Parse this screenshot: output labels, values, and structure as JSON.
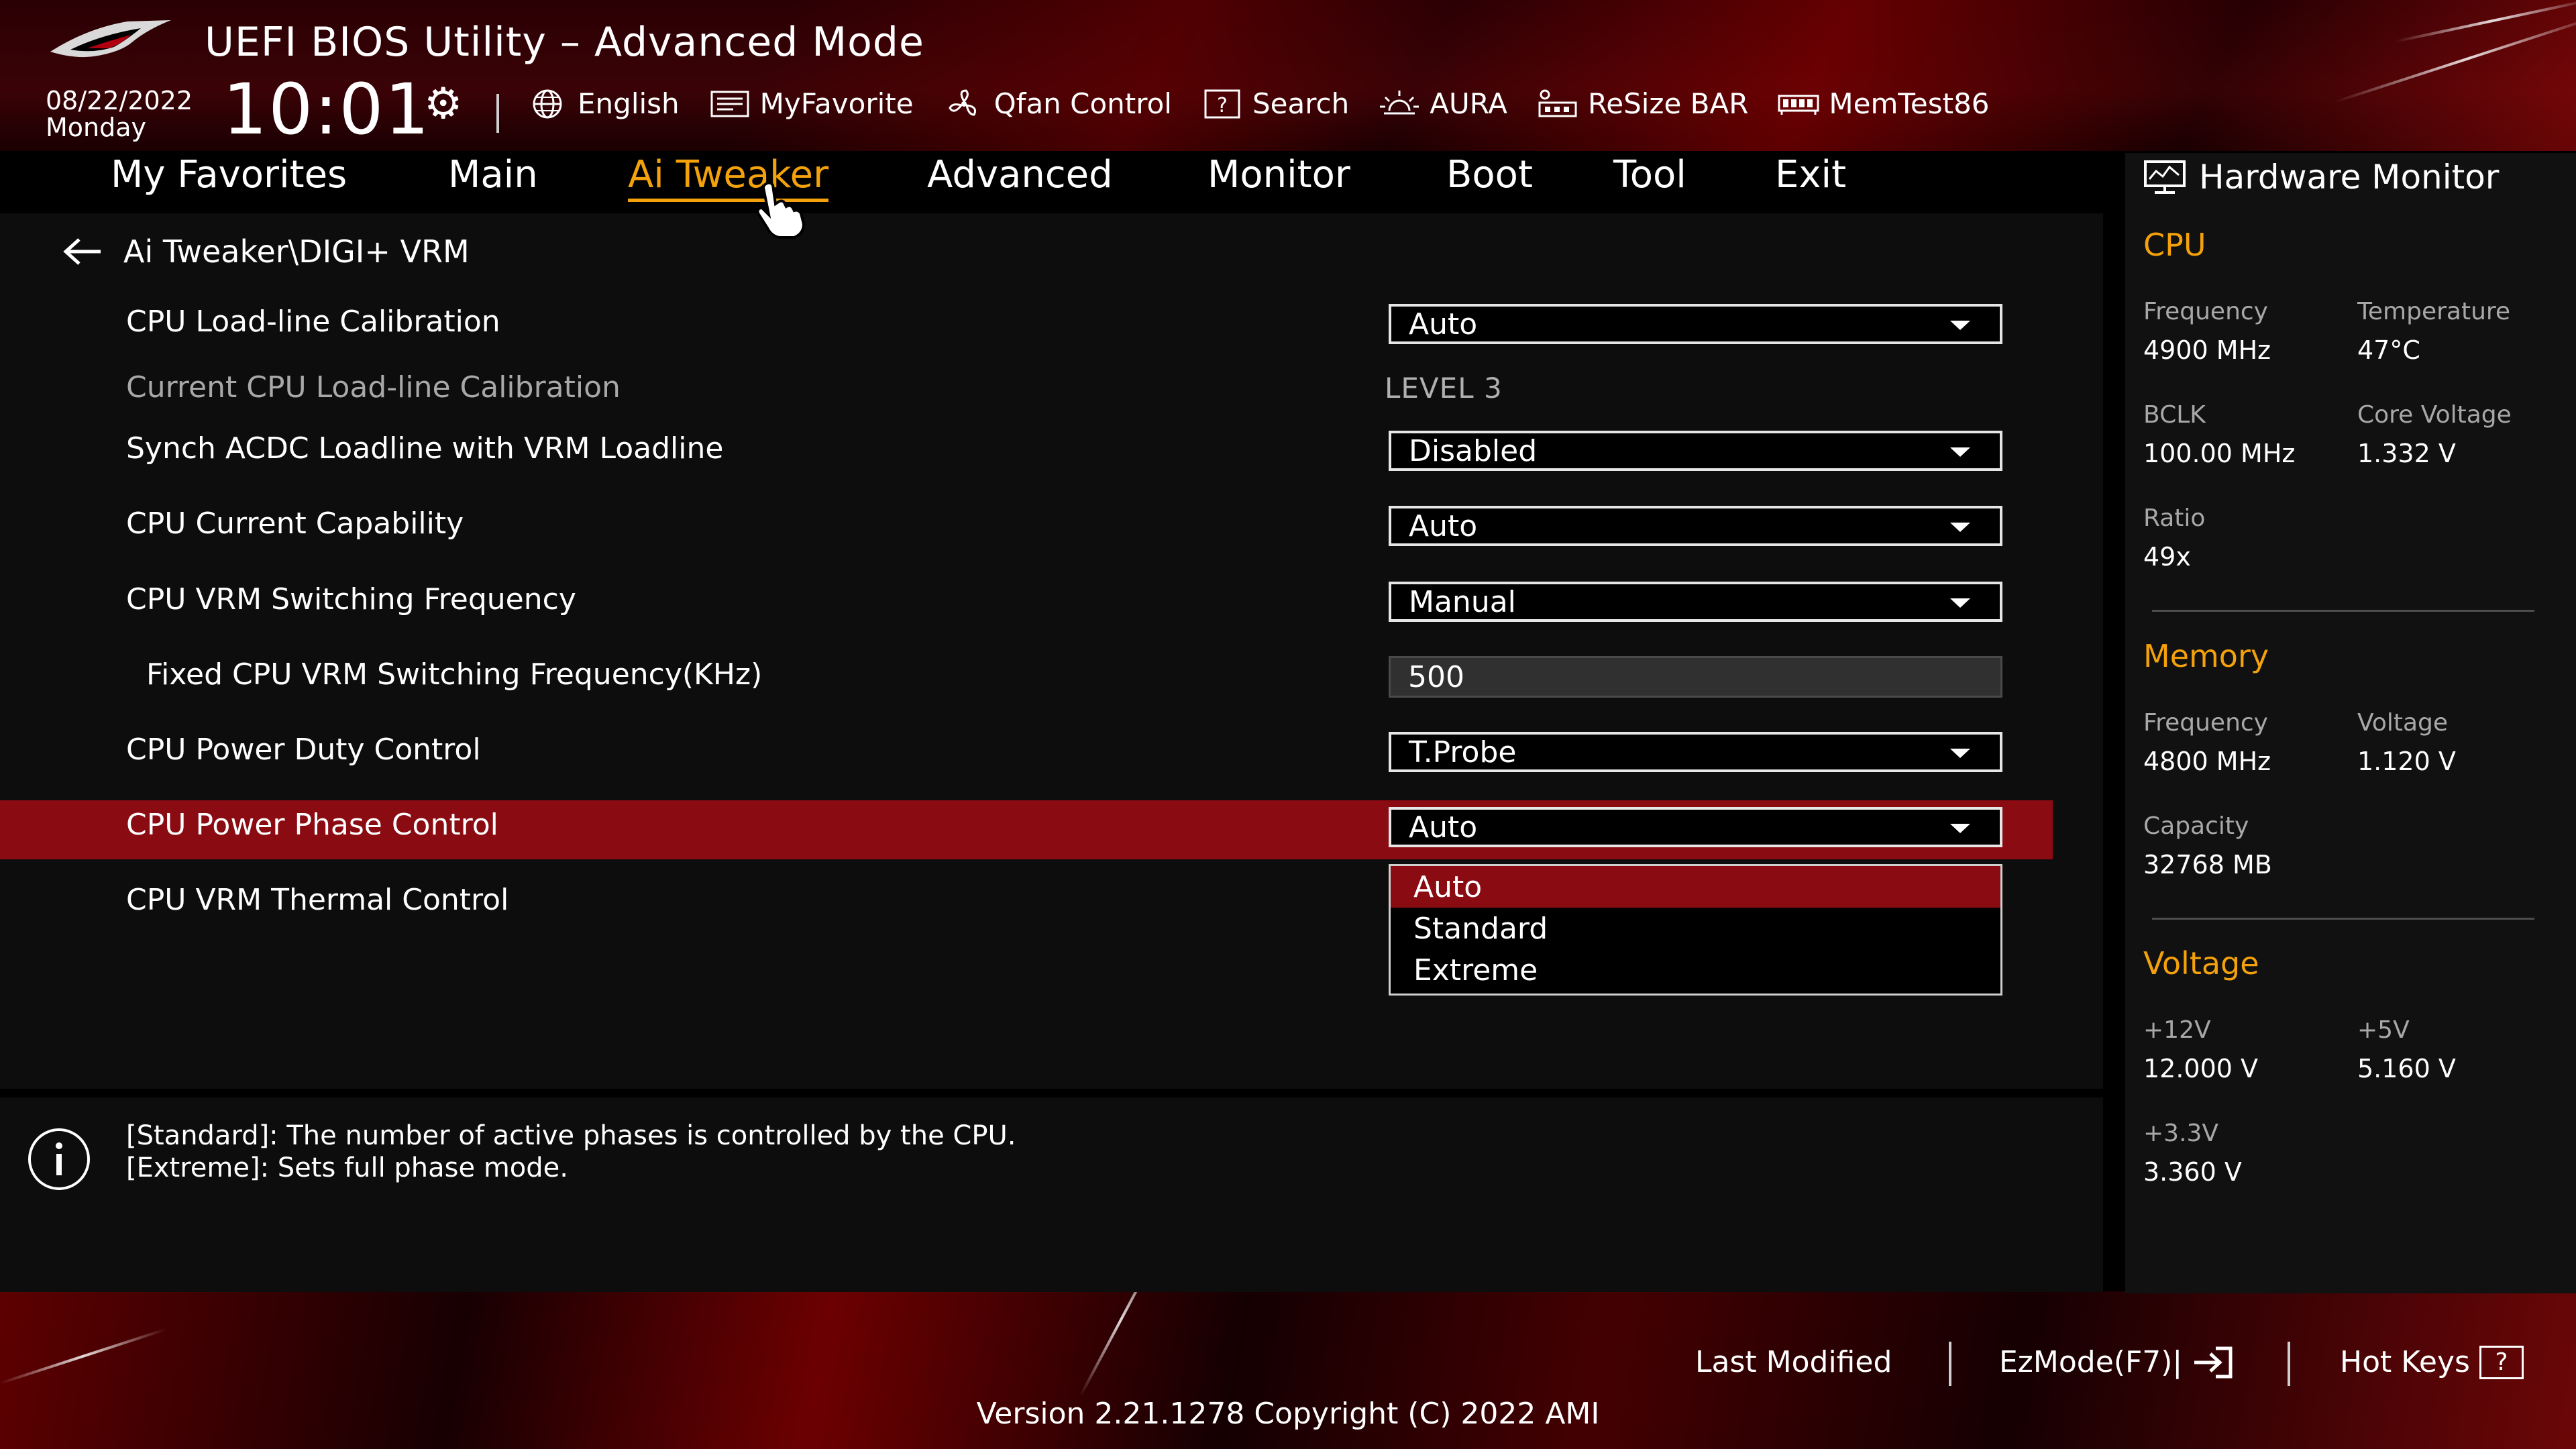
{
  "header": {
    "title": "UEFI BIOS Utility – Advanced Mode",
    "date": "08/22/2022",
    "day": "Monday",
    "time": "10:01",
    "tools": [
      {
        "label": "English",
        "icon": "globe-icon"
      },
      {
        "label": "MyFavorite",
        "icon": "favorite-icon"
      },
      {
        "label": "Qfan Control",
        "icon": "fan-icon"
      },
      {
        "label": "Search",
        "icon": "search-help-icon"
      },
      {
        "label": "AURA",
        "icon": "aura-icon"
      },
      {
        "label": "ReSize BAR",
        "icon": "resize-bar-icon"
      },
      {
        "label": "MemTest86",
        "icon": "memtest-icon"
      }
    ]
  },
  "tabs": [
    {
      "label": "My Favorites"
    },
    {
      "label": "Main"
    },
    {
      "label": "Ai Tweaker",
      "active": true
    },
    {
      "label": "Advanced"
    },
    {
      "label": "Monitor"
    },
    {
      "label": "Boot"
    },
    {
      "label": "Tool"
    },
    {
      "label": "Exit"
    }
  ],
  "breadcrumb": "Ai Tweaker\\DIGI+ VRM",
  "settings": [
    {
      "label": "CPU Load-line Calibration",
      "value": "Auto"
    },
    {
      "label": "Current CPU Load-line Calibration",
      "value": "LEVEL 3"
    },
    {
      "label": "Synch ACDC Loadline with VRM Loadline",
      "value": "Disabled"
    },
    {
      "label": "CPU Current Capability",
      "value": "Auto"
    },
    {
      "label": "CPU VRM Switching Frequency",
      "value": "Manual"
    },
    {
      "label": "Fixed CPU VRM Switching Frequency(KHz)",
      "value": "500"
    },
    {
      "label": "CPU Power Duty Control",
      "value": "T.Probe"
    },
    {
      "label": "CPU Power Phase Control",
      "value": "Auto"
    },
    {
      "label": "CPU VRM Thermal Control"
    }
  ],
  "dropdown": {
    "options": [
      "Auto",
      "Standard",
      "Extreme"
    ],
    "selected": "Auto"
  },
  "help": [
    "[Standard]: The number of active phases is controlled by the CPU.",
    "[Extreme]: Sets full phase mode."
  ],
  "hardware_monitor": {
    "title": "Hardware Monitor",
    "cpu": {
      "heading": "CPU",
      "frequency_label": "Frequency",
      "frequency": "4900 MHz",
      "temperature_label": "Temperature",
      "temperature": "47°C",
      "bclk_label": "BCLK",
      "bclk": "100.00 MHz",
      "core_voltage_label": "Core Voltage",
      "core_voltage": "1.332 V",
      "ratio_label": "Ratio",
      "ratio": "49x"
    },
    "memory": {
      "heading": "Memory",
      "frequency_label": "Frequency",
      "frequency": "4800 MHz",
      "voltage_label": "Voltage",
      "voltage": "1.120 V",
      "capacity_label": "Capacity",
      "capacity": "32768 MB"
    },
    "voltage": {
      "heading": "Voltage",
      "v12_label": "+12V",
      "v12": "12.000 V",
      "v5_label": "+5V",
      "v5": "5.160 V",
      "v33_label": "+3.3V",
      "v33": "3.360 V"
    }
  },
  "footer": {
    "last_modified": "Last Modified",
    "ezmode": "EzMode(F7)|",
    "hotkeys": "Hot Keys",
    "hotkeys_key": "?",
    "version": "Version 2.21.1278 Copyright (C) 2022 AMI"
  },
  "colors": {
    "accent": "#f3a20b",
    "highlight": "#8a0b12",
    "background": "#0d0d0d"
  }
}
